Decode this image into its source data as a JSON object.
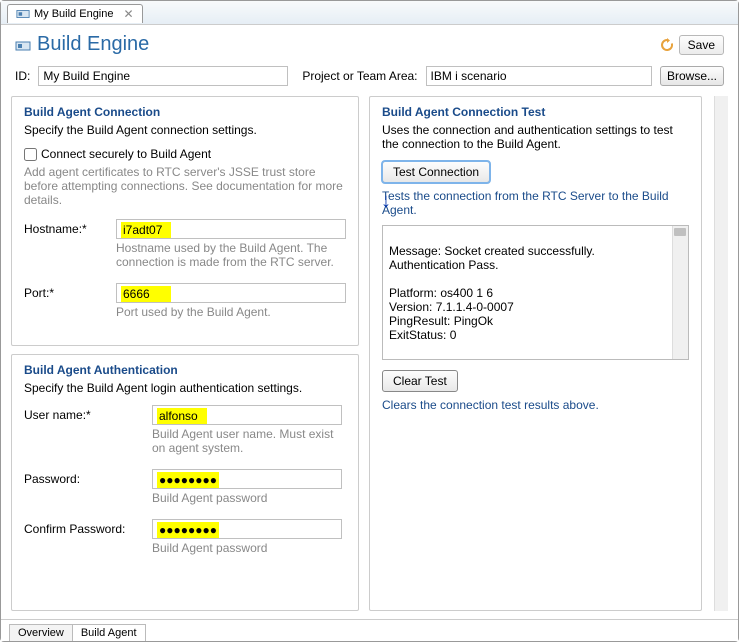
{
  "tab": {
    "title": "My Build Engine"
  },
  "header": {
    "title": "Build Engine",
    "save": "Save"
  },
  "idRow": {
    "idLabel": "ID:",
    "idValue": "My Build Engine",
    "areaLabel": "Project or Team Area:",
    "areaValue": "IBM i scenario",
    "browse": "Browse..."
  },
  "connection": {
    "title": "Build Agent Connection",
    "desc": "Specify the Build Agent connection settings.",
    "secure": "Connect securely to Build Agent",
    "secureHint": "Add agent certificates to RTC server's JSSE trust store before attempting connections.  See documentation for more details.",
    "hostLabel": "Hostname:*",
    "hostValue": "i7adt07",
    "hostHint": "Hostname used by the Build Agent.  The connection is made from the RTC server.",
    "portLabel": "Port:*",
    "portValue": "6666",
    "portHint": "Port used by the Build Agent."
  },
  "auth": {
    "title": "Build Agent Authentication",
    "desc": "Specify the Build Agent login authentication settings.",
    "userLabel": "User name:*",
    "userValue": "alfonso",
    "userHint": "Build Agent user name.  Must exist on agent system.",
    "pwLabel": "Password:",
    "pwValue": "●●●●●●●●",
    "pwHint": "Build Agent password",
    "cpwLabel": "Confirm Password:",
    "cpwValue": "●●●●●●●●",
    "cpwHint": "Build Agent password"
  },
  "test": {
    "title": "Build Agent Connection Test",
    "desc": "Uses the connection and authentication settings to test the connection to the Build Agent.",
    "btn": "Test Connection",
    "btnHint": "Tests the connection from the RTC Server to the Build Agent.",
    "result": "Message: Socket created successfully.\nAuthentication Pass.\n\nPlatform: os400 1 6\nVersion: 7.1.1.4-0-0007\nPingResult: PingOk\nExitStatus: 0",
    "clear": "Clear Test",
    "clearHint": "Clears the connection test results above."
  },
  "bottomTabs": {
    "overview": "Overview",
    "buildAgent": "Build Agent"
  }
}
